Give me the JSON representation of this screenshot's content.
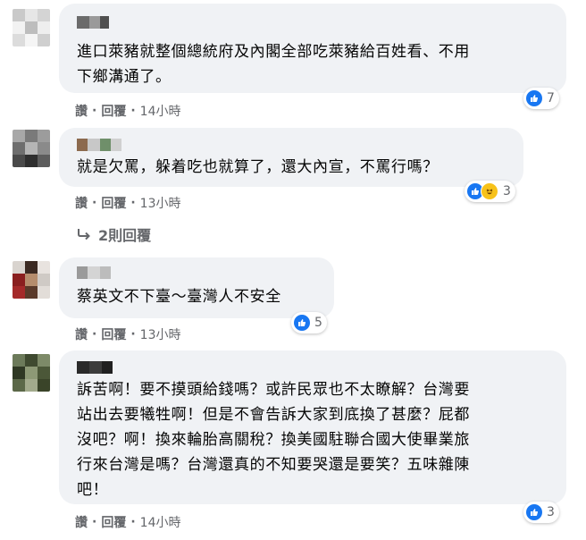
{
  "comments": [
    {
      "text_lines": [
        "進口萊豬就整個總統府及內閣全部吃萊豬給百姓看、不用",
        "下鄉溝通了。"
      ],
      "like_label": "讚",
      "reply_label": "回覆",
      "time": "14小時",
      "reaction_count": "7"
    },
    {
      "text_lines": [
        "就是欠罵，躲着吃也就算了，還大內宣，不罵行嗎？"
      ],
      "like_label": "讚",
      "reply_label": "回覆",
      "time": "13小時",
      "reaction_count": "3",
      "replies_link": "2則回覆"
    },
    {
      "text_lines": [
        "蔡英文不下臺～臺灣人不安全"
      ],
      "like_label": "讚",
      "reply_label": "回覆",
      "time": "13小時",
      "reaction_count": "5"
    },
    {
      "text_lines": [
        "訴苦啊！要不摸頭給錢嗎？或許民眾也不太瞭解？台灣要",
        "站出去要犧牲啊！但是不會告訴大家到底換了甚麼？屁都",
        "沒吧？啊！換來輪胎高關稅？換美國駐聯合國大使畢業旅",
        "行來台灣是嗎？台灣還真的不知要哭還是要笑？五味雜陳",
        "吧！"
      ],
      "like_label": "讚",
      "reply_label": "回覆",
      "time": "14小時",
      "reaction_count": "3"
    }
  ],
  "colors": {
    "bubble": "#f0f2f5",
    "meta": "#65676b",
    "like_blue": "#1877f2"
  },
  "icons": [
    "like-icon",
    "haha-icon",
    "reply-arrow-icon"
  ]
}
